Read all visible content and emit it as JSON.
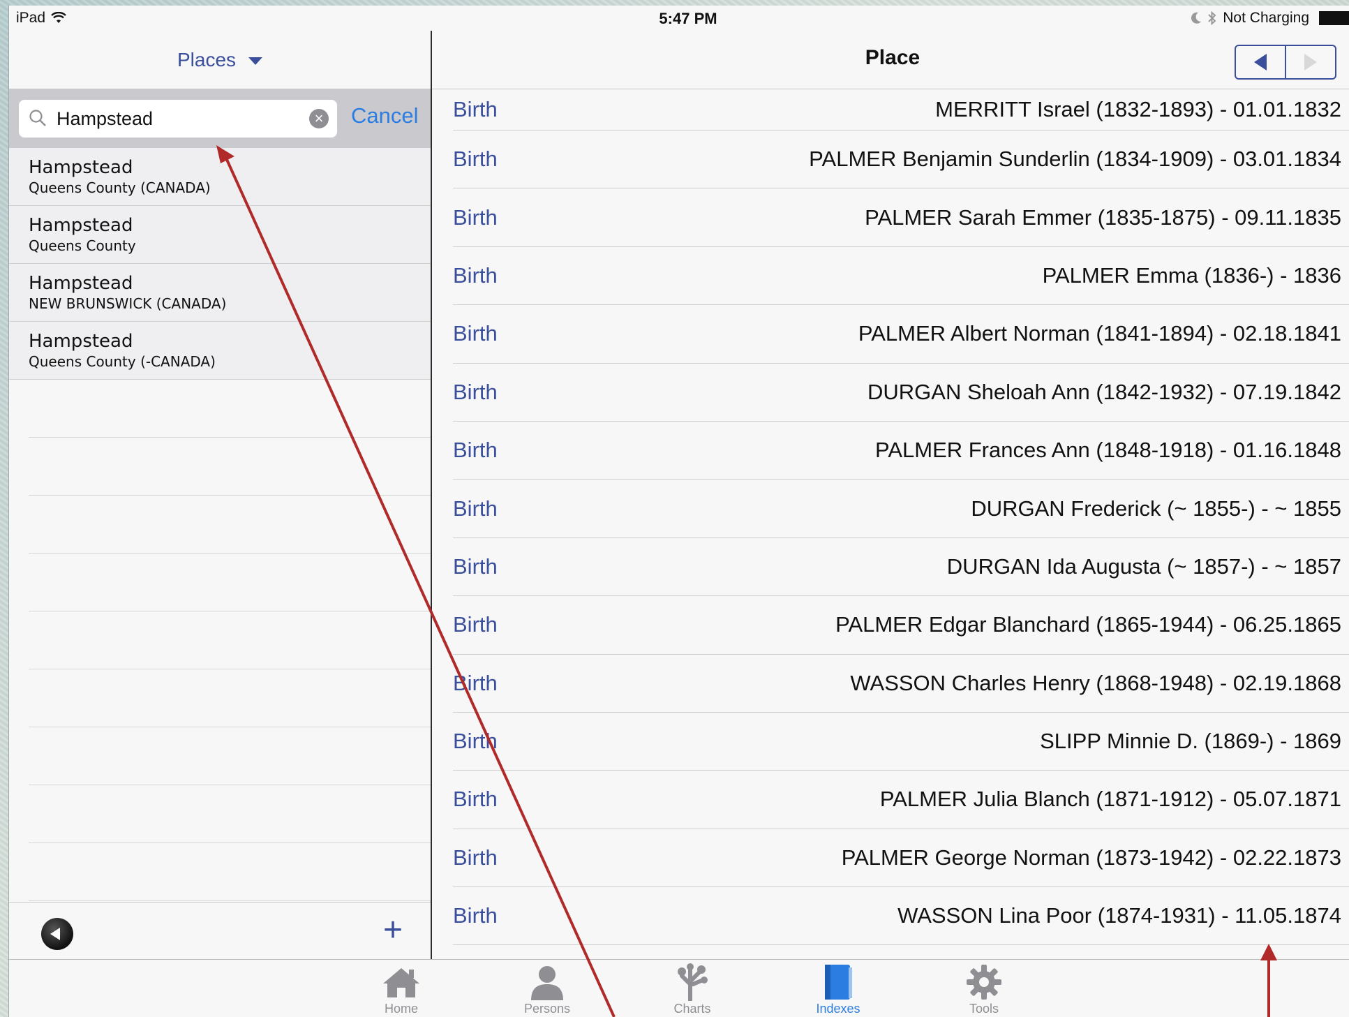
{
  "status_bar": {
    "device": "iPad",
    "time": "5:47 PM",
    "battery_text": "Not Charging"
  },
  "master": {
    "header_label": "Places",
    "search": {
      "value": "Hampstead",
      "cancel_label": "Cancel"
    },
    "results": [
      {
        "title": "Hampstead",
        "subtitle": "Queens County (CANADA)"
      },
      {
        "title": "Hampstead",
        "subtitle": "Queens County"
      },
      {
        "title": "Hampstead",
        "subtitle": "NEW BRUNSWICK (CANADA)"
      },
      {
        "title": "Hampstead",
        "subtitle": "Queens County (-CANADA)"
      }
    ]
  },
  "detail": {
    "title": "Place",
    "rows": [
      {
        "type": "Birth",
        "desc": "MERRITT Israel  (1832-1893) - 01.01.1832"
      },
      {
        "type": "Birth",
        "desc": "PALMER Benjamin Sunderlin  (1834-1909) - 03.01.1834"
      },
      {
        "type": "Birth",
        "desc": "PALMER Sarah Emmer  (1835-1875) - 09.11.1835"
      },
      {
        "type": "Birth",
        "desc": "PALMER Emma  (1836-) - 1836"
      },
      {
        "type": "Birth",
        "desc": "PALMER Albert Norman  (1841-1894) - 02.18.1841"
      },
      {
        "type": "Birth",
        "desc": "DURGAN Sheloah Ann  (1842-1932) - 07.19.1842"
      },
      {
        "type": "Birth",
        "desc": "PALMER Frances Ann  (1848-1918) - 01.16.1848"
      },
      {
        "type": "Birth",
        "desc": "DURGAN Frederick  (~ 1855-) - ~ 1855"
      },
      {
        "type": "Birth",
        "desc": "DURGAN Ida Augusta  (~ 1857-) - ~ 1857"
      },
      {
        "type": "Birth",
        "desc": "PALMER Edgar Blanchard  (1865-1944) - 06.25.1865"
      },
      {
        "type": "Birth",
        "desc": "WASSON Charles Henry  (1868-1948) - 02.19.1868"
      },
      {
        "type": "Birth",
        "desc": "SLIPP Minnie D.  (1869-) - 1869"
      },
      {
        "type": "Birth",
        "desc": "PALMER Julia Blanch  (1871-1912) - 05.07.1871"
      },
      {
        "type": "Birth",
        "desc": "PALMER George Norman  (1873-1942) - 02.22.1873"
      },
      {
        "type": "Birth",
        "desc": "WASSON Lina Poor  (1874-1931) - 11.05.1874"
      }
    ]
  },
  "tabbar": {
    "tabs": [
      {
        "label": "Home",
        "icon": "home-icon"
      },
      {
        "label": "Persons",
        "icon": "person-icon"
      },
      {
        "label": "Charts",
        "icon": "tree-icon"
      },
      {
        "label": "Indexes",
        "icon": "book-icon",
        "active": true
      },
      {
        "label": "Tools",
        "icon": "gear-icon"
      }
    ]
  },
  "colors": {
    "accent": "#3a4f9c",
    "ios_blue": "#2b7de1",
    "annotation_arrow": "#b02a2a"
  }
}
